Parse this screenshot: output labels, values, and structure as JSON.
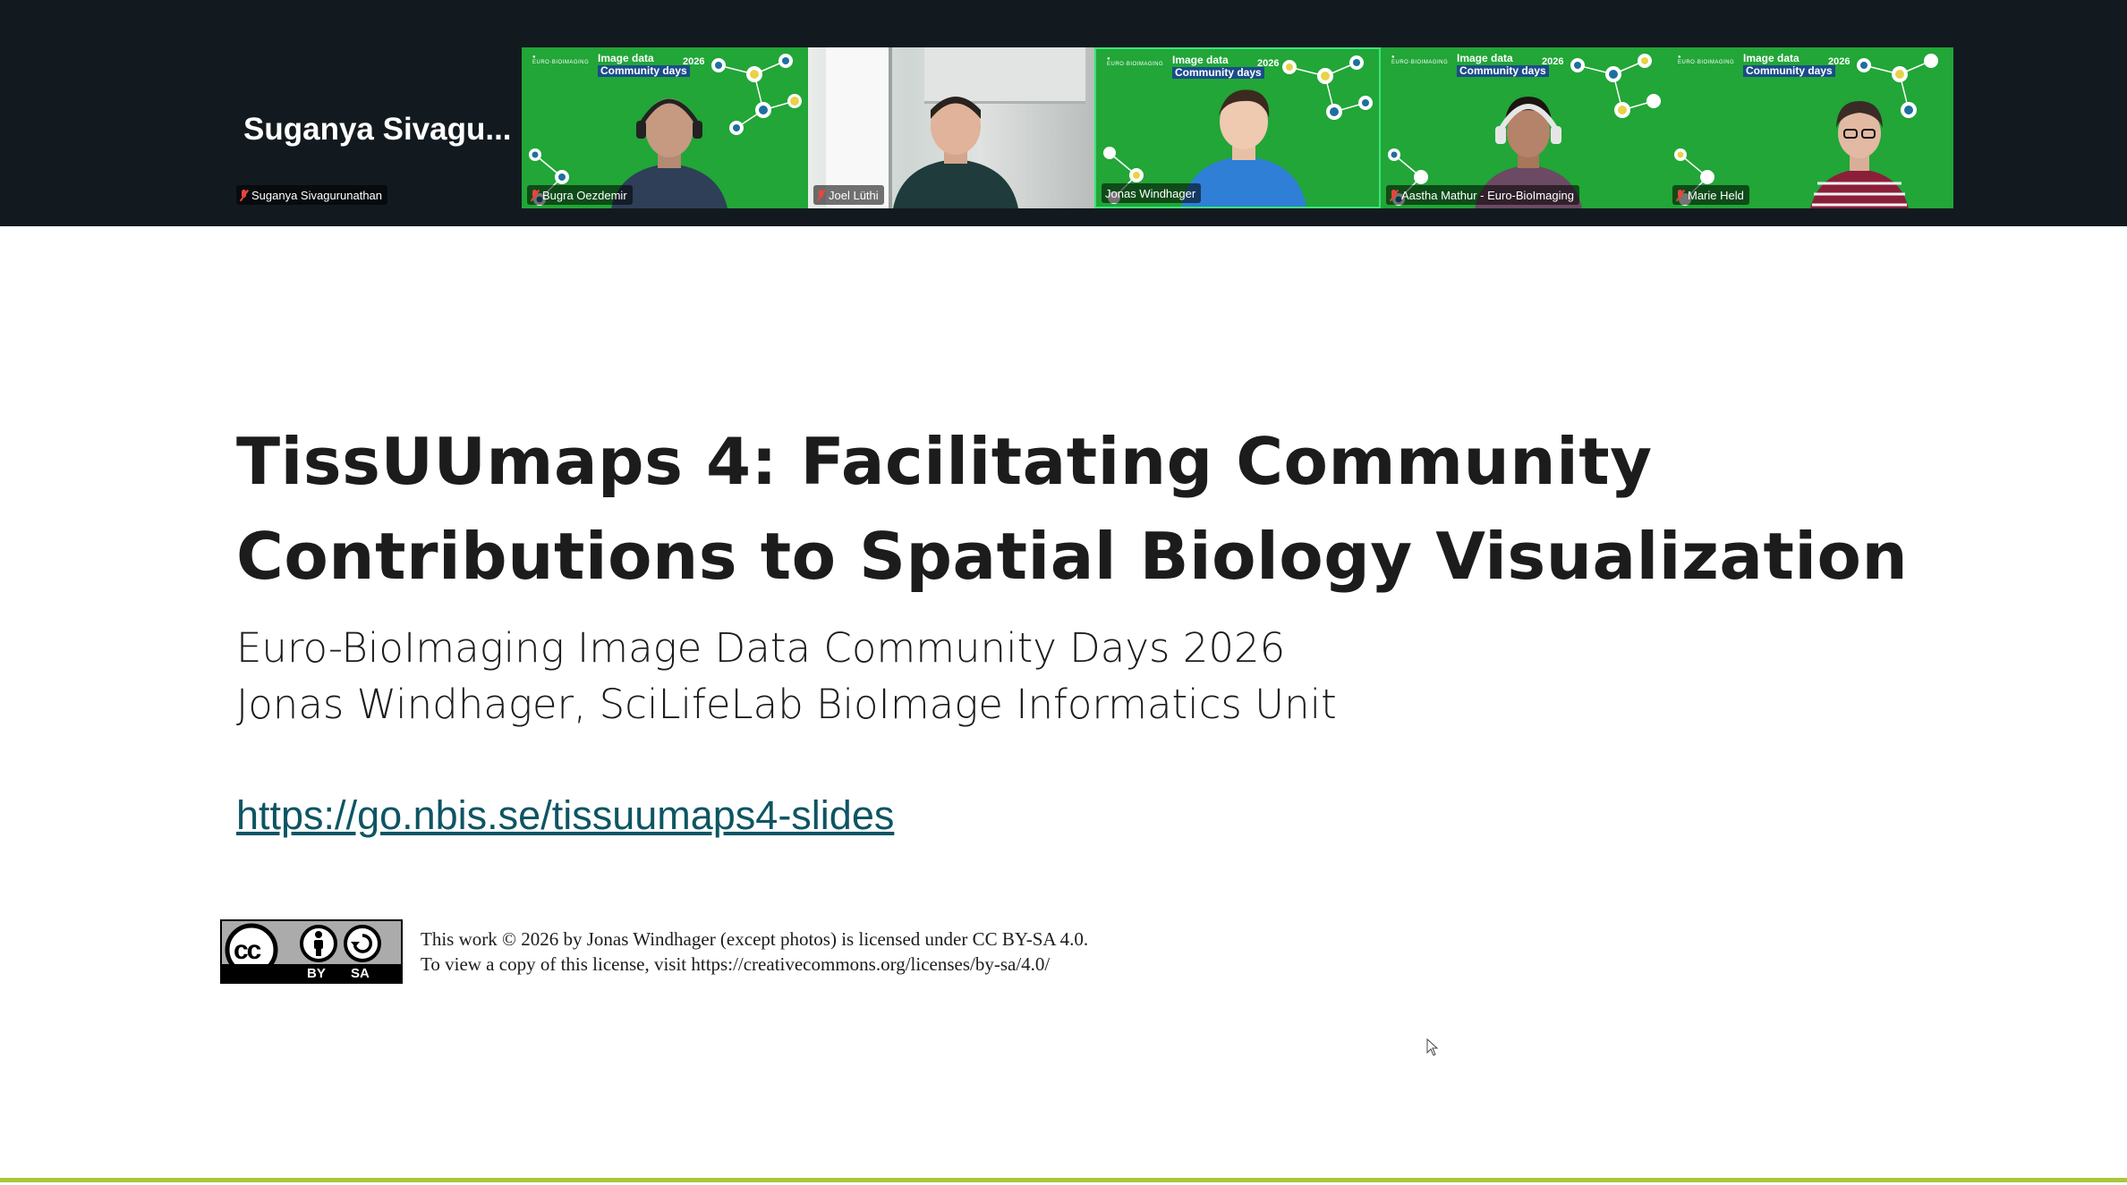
{
  "participants": {
    "self": {
      "display_name_large": "Suganya  Sivagu...",
      "name_tag": "Suganya Sivagurunathan"
    },
    "tiles": [
      {
        "name": "Bugra Oezdemir",
        "background": "green",
        "muted": true
      },
      {
        "name": "Joel Lüthi",
        "background": "office",
        "muted": true
      },
      {
        "name": "Jonas Windhager",
        "background": "green",
        "muted": false,
        "active_speaker": true
      },
      {
        "name": "Aastha Mathur - Euro-BioImaging",
        "background": "green",
        "muted": true
      },
      {
        "name": "Marie Held",
        "background": "green",
        "muted": true
      }
    ],
    "virtual_background": {
      "line1": "Image data",
      "line2": "Community days",
      "year": "2026"
    }
  },
  "slide": {
    "title_line1": "TissUUmaps 4: Facilitating Community",
    "title_line2": "Contributions to Spatial Biology Visualization",
    "subtitle_line1": "Euro-BioImaging Image Data Community Days 2026",
    "subtitle_line2": "Jonas Windhager, SciLifeLab BioImage Informatics Unit",
    "link": "https://go.nbis.se/tissuumaps4-slides",
    "license_badge": {
      "cc": "cc",
      "by": "BY",
      "sa": "SA"
    },
    "license_line1": "This work © 2026 by Jonas Windhager (except photos) is licensed under CC BY-SA 4.0.",
    "license_line2": "To view a copy of this license, visit https://creativecommons.org/licenses/by-sa/4.0/"
  },
  "colors": {
    "topbar": "#131a1f",
    "green_screen": "#21a637",
    "active_border": "#3be37a",
    "link": "#0d5563",
    "accent_rule": "#a8c83a",
    "muted_mic": "#e8453c"
  },
  "icons": [
    "mic-off-icon",
    "cursor-icon",
    "cc-icon",
    "by-person-icon",
    "sa-icon"
  ]
}
